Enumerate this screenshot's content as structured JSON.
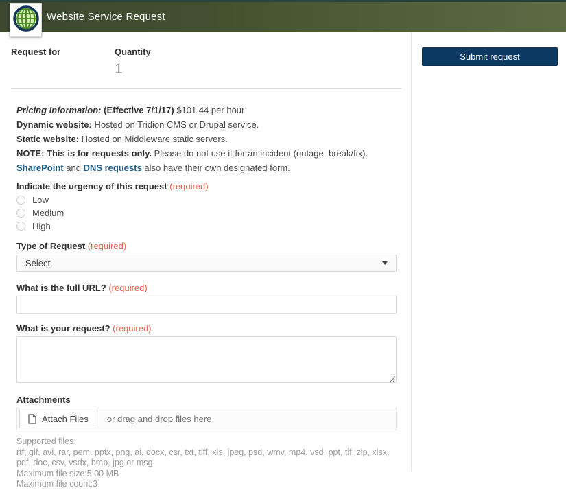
{
  "header": {
    "title": "Website Service Request",
    "icon": "globe"
  },
  "meta": {
    "request_for_label": "Request for",
    "quantity_label": "Quantity",
    "quantity_value": "1"
  },
  "info": {
    "pricing_label": "Pricing Information:",
    "pricing_effective": " (Effective 7/1/17)",
    "pricing_rest": " $101.44 per hour",
    "dynamic_label": "Dynamic website:",
    "dynamic_text": " Hosted on Tridion CMS or Drupal service.",
    "static_label": "Static website:",
    "static_text": " Hosted on Middleware static servers.",
    "note_label": "NOTE:  This is for requests only.",
    "note_text": " Please do not use it for an incident (outage, break/fix).",
    "link_sharepoint": "SharePoint",
    "link_mid": " and ",
    "link_dns": "DNS requests",
    "link_rest": " also have their own designated form."
  },
  "form": {
    "required_text": "(required)",
    "urgency": {
      "label": "Indicate the urgency of this request",
      "options": [
        "Low",
        "Medium",
        "High"
      ]
    },
    "type_of_request": {
      "label": "Type of Request",
      "selected_value": "Select"
    },
    "url_question": {
      "label": "What is the full URL?",
      "value": ""
    },
    "request_question": {
      "label": "What is your request?",
      "value": ""
    },
    "attachments": {
      "label": "Attachments",
      "attach_button_label": "Attach Files",
      "drag_text": "or drag and drop files here",
      "supported_label": "Supported files:",
      "supported_list": "rtf, gif, avi, rar, pem, pptx, png, ai, docx, csr, txt, tiff, xls, jpeg, psd, wmv, mp4, vsd, ppt, tif, zip, xlsx, pdf, doc, csv, vsdx, bmp, jpg or msg",
      "max_size": "Maximum file size:5.00 MB",
      "max_count": "Maximum file count:3"
    }
  },
  "sidebar": {
    "submit_label": "Submit request"
  },
  "colors": {
    "header_gradient_start": "#3c4830",
    "header_gradient_end": "#5c6b44",
    "submit_navy": "#0d3a63",
    "required_red": "#e35f4b",
    "link_blue": "#1d5c8a",
    "globe_green": "#8cc63f",
    "globe_navy": "#16355a"
  }
}
